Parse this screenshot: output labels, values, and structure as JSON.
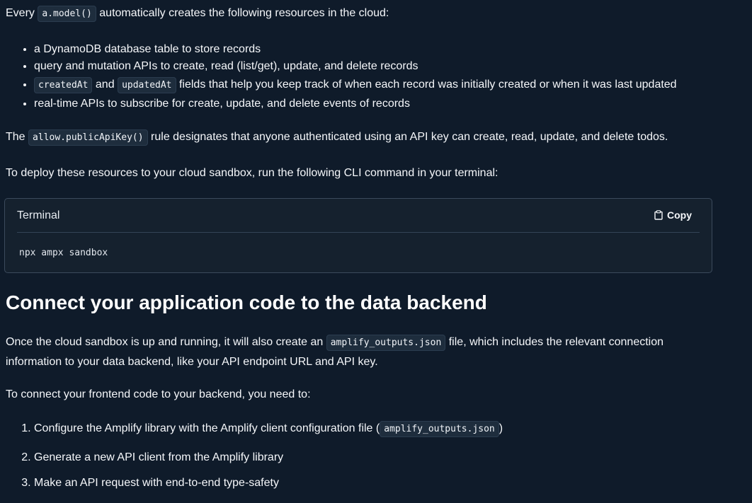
{
  "intro": {
    "prefix": "Every",
    "code": "a.model()",
    "suffix": "automatically creates the following resources in the cloud:"
  },
  "resources": {
    "item1": "a DynamoDB database table to store records",
    "item2": "query and mutation APIs to create, read (list/get), update, and delete records",
    "item3_code1": "createdAt",
    "item3_and": "and",
    "item3_code2": "updatedAt",
    "item3_suffix": "fields that help you keep track of when each record was initially created or when it was last updated",
    "item4": "real-time APIs to subscribe for create, update, and delete events of records"
  },
  "rule": {
    "prefix": "The",
    "code": "allow.publicApiKey()",
    "suffix": "rule designates that anyone authenticated using an API key can create, read, update, and delete todos."
  },
  "deploy": {
    "text": "To deploy these resources to your cloud sandbox, run the following CLI command in your terminal:"
  },
  "terminal": {
    "title": "Terminal",
    "copy_label": "Copy",
    "command": "npx ampx sandbox"
  },
  "section": {
    "heading": "Connect your application code to the data backend"
  },
  "once": {
    "prefix": "Once the cloud sandbox is up and running, it will also create an",
    "code": "amplify_outputs.json",
    "suffix": "file, which includes the relevant connection information to your data backend, like your API endpoint URL and API key."
  },
  "connect": {
    "text": "To connect your frontend code to your backend, you need to:"
  },
  "steps": {
    "step1_prefix": "Configure the Amplify library with the Amplify client configuration file (",
    "step1_code": "amplify_outputs.json",
    "step1_suffix": ")",
    "step2": "Generate a new API client from the Amplify library",
    "step3": "Make an API request with end-to-end type-safety"
  },
  "colors": {
    "background": "#0f1b2a",
    "code_background": "#1e2d3d",
    "terminal_background": "#15212e"
  }
}
